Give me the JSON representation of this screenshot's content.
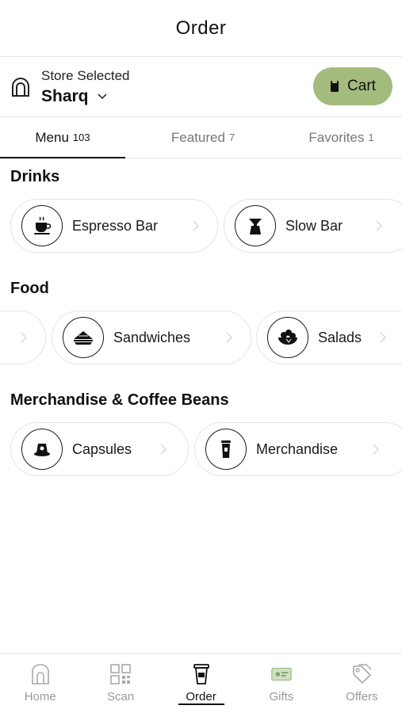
{
  "header": {
    "title": "Order"
  },
  "store": {
    "label": "Store Selected",
    "name": "Sharq"
  },
  "cart": {
    "label": "Cart"
  },
  "colors": {
    "accent": "#a4bb7e",
    "text": "#111111",
    "muted": "#999999"
  },
  "tabs": [
    {
      "label": "Menu",
      "count": "103",
      "active": true
    },
    {
      "label": "Featured",
      "count": "7",
      "active": false
    },
    {
      "label": "Favorites",
      "count": "1",
      "active": false
    }
  ],
  "sections": [
    {
      "title": "Drinks",
      "items": [
        {
          "label": "Espresso Bar",
          "icon": "coffee-cup-icon"
        },
        {
          "label": "Slow Bar",
          "icon": "pour-over-icon"
        }
      ]
    },
    {
      "title": "Food",
      "items": [
        {
          "label": "",
          "icon": ""
        },
        {
          "label": "Sandwiches",
          "icon": "sandwich-icon"
        },
        {
          "label": "Salads",
          "icon": "salad-bowl-icon"
        }
      ]
    },
    {
      "title": "Merchandise & Coffee Beans",
      "items": [
        {
          "label": "Capsules",
          "icon": "capsule-icon"
        },
        {
          "label": "Merchandise",
          "icon": "tumbler-icon"
        }
      ]
    }
  ],
  "nav": [
    {
      "label": "Home",
      "icon": "home-icon",
      "active": false
    },
    {
      "label": "Scan",
      "icon": "qr-code-icon",
      "active": false
    },
    {
      "label": "Order",
      "icon": "cup-icon",
      "active": true
    },
    {
      "label": "Gifts",
      "icon": "gift-card-icon",
      "active": false
    },
    {
      "label": "Offers",
      "icon": "tag-icon",
      "active": false
    }
  ]
}
